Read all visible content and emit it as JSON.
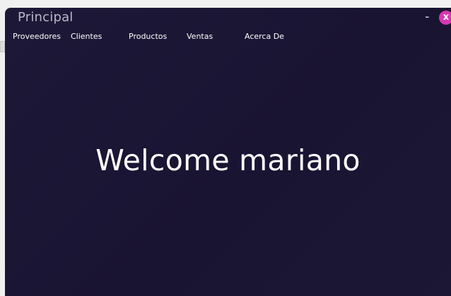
{
  "window": {
    "title": "Principal",
    "minimize_label": "-",
    "close_label": "x"
  },
  "menu": {
    "items": [
      {
        "label": "Proveedores"
      },
      {
        "label": "Clientes"
      },
      {
        "label": "Productos"
      },
      {
        "label": "Ventas"
      },
      {
        "label": "Acerca De"
      }
    ]
  },
  "main": {
    "welcome_text": "Welcome mariano"
  },
  "colors": {
    "background": "#1b1634",
    "close_button": "#d737b3",
    "title_text": "#b9b6c8",
    "text": "#ffffff"
  }
}
